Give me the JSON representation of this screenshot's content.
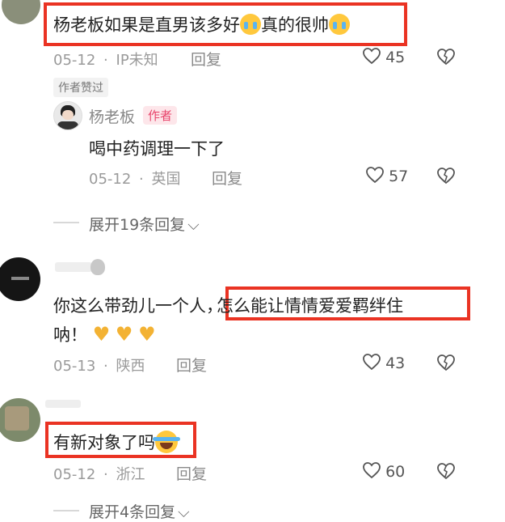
{
  "comments": [
    {
      "text": "杨老板如果是直男该多好",
      "text_tail": "真的很帅",
      "date": "05-12",
      "location": "IP未知",
      "reply": "回复",
      "likes": "45",
      "author_liked": "作者赞过",
      "reply_block": {
        "username": "杨老板",
        "author_badge": "作者",
        "text": "喝中药调理一下了",
        "date": "05-12",
        "location": "英国",
        "reply": "回复",
        "likes": "57"
      },
      "expand": "展开19条回复"
    },
    {
      "text_line1_a": "你这么带劲儿一个人，",
      "text_line1_b": "怎么能让情情爱爱羁绊住",
      "text_line2": "呐！",
      "date": "05-13",
      "location": "陕西",
      "reply": "回复",
      "likes": "43"
    },
    {
      "text": "有新对象了吗",
      "date": "05-12",
      "location": "浙江",
      "reply": "回复",
      "likes": "60",
      "expand": "展开4条回复"
    }
  ],
  "separator": "·",
  "colors": {
    "highlight": "#ea3323",
    "author_badge": "#e8456c"
  }
}
